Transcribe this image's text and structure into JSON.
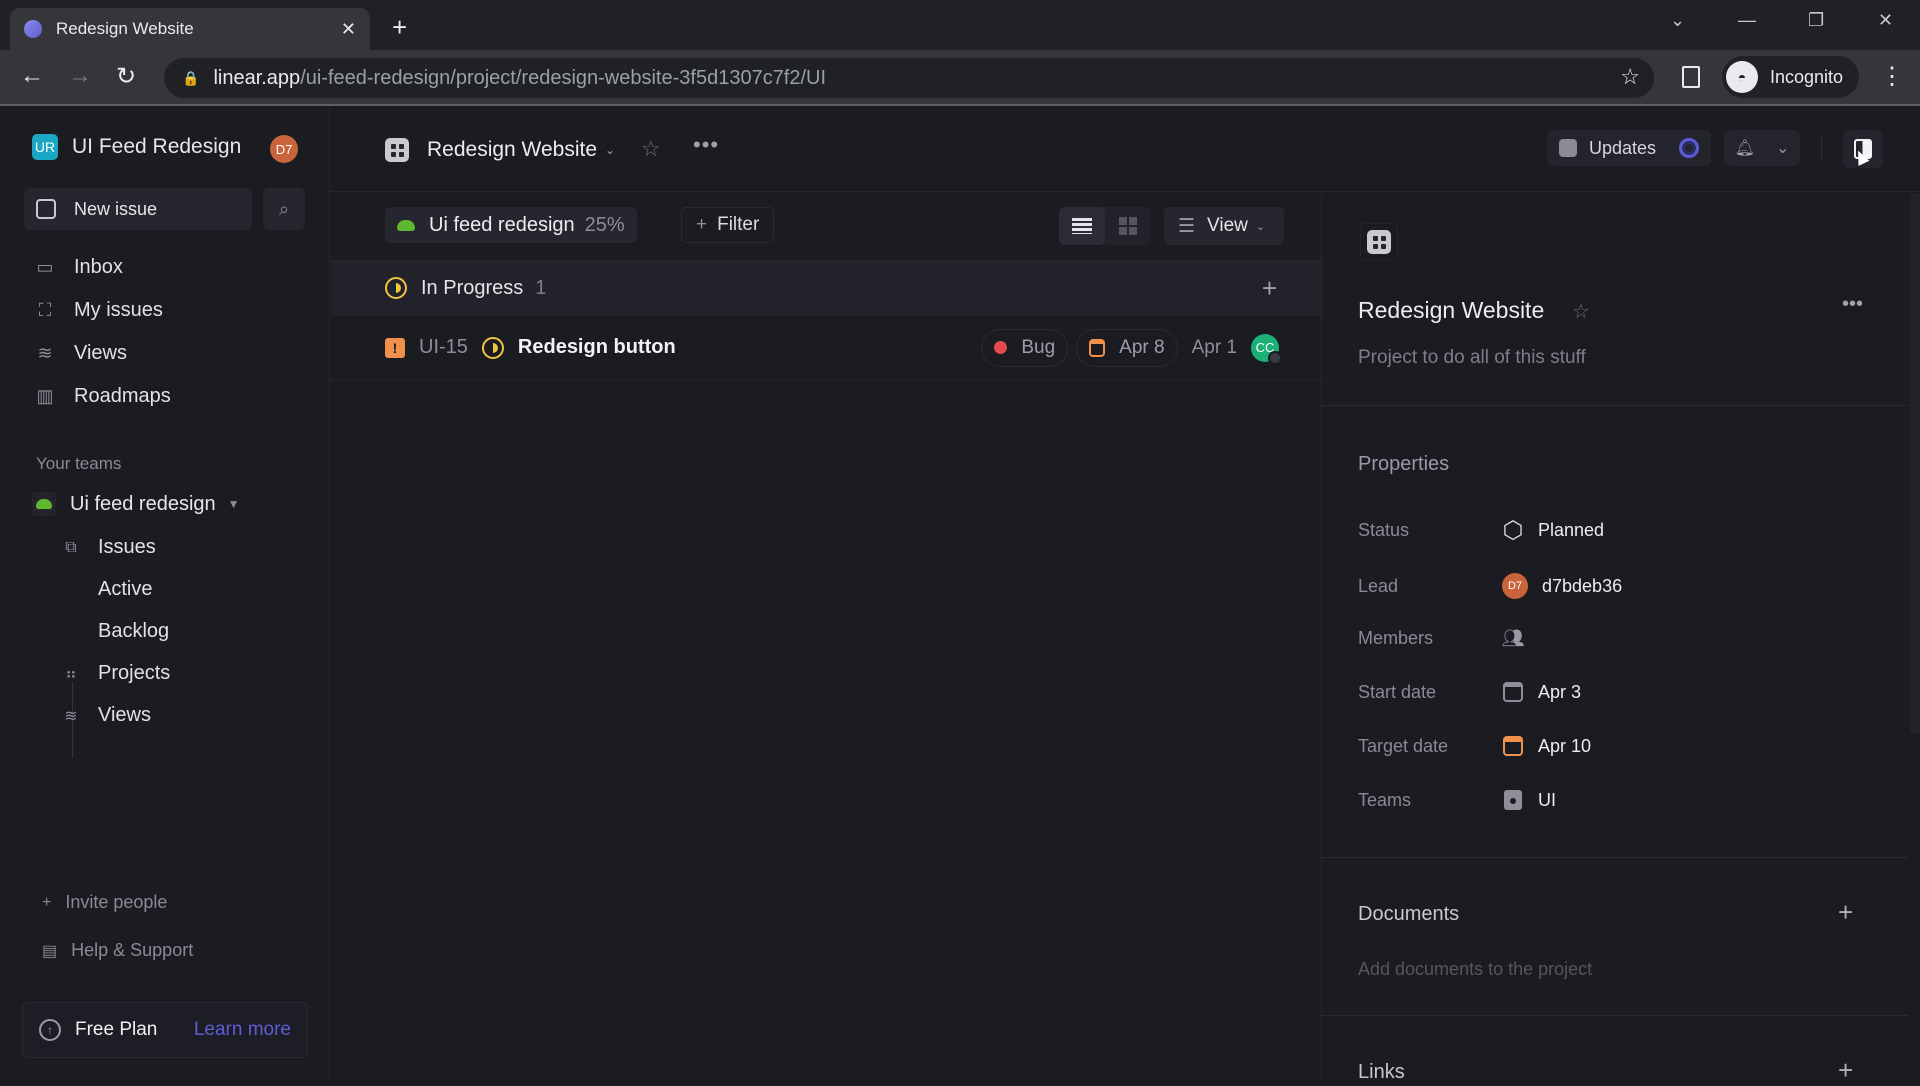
{
  "browser": {
    "tab_title": "Redesign Website",
    "url_host": "linear.app",
    "url_path": "/ui-feed-redesign/project/redesign-website-3f5d1307c7f2/UI",
    "profile_label": "Incognito"
  },
  "sidebar": {
    "workspace_logo": "UR",
    "workspace_name": "UI Feed Redesign",
    "user_avatar": "D7",
    "new_issue_label": "New issue",
    "nav": [
      {
        "label": "Inbox",
        "icon": "inbox-icon"
      },
      {
        "label": "My issues",
        "icon": "my-issues-icon"
      },
      {
        "label": "Views",
        "icon": "layers-icon"
      },
      {
        "label": "Roadmaps",
        "icon": "map-icon"
      }
    ],
    "teams_label": "Your teams",
    "team": {
      "name": "Ui feed redesign",
      "items": [
        {
          "label": "Issues"
        },
        {
          "label": "Active"
        },
        {
          "label": "Backlog"
        },
        {
          "label": "Projects"
        },
        {
          "label": "Views"
        }
      ]
    },
    "invite_label": "Invite people",
    "help_label": "Help & Support",
    "plan_label": "Free Plan",
    "learn_more_label": "Learn more"
  },
  "header": {
    "project_title": "Redesign Website",
    "updates_label": "Updates"
  },
  "list": {
    "team_chip_label": "Ui feed redesign",
    "team_chip_progress": "25%",
    "filter_label": "Filter",
    "view_label": "View",
    "group": {
      "status": "In Progress",
      "count": "1"
    },
    "issues": [
      {
        "id": "UI-15",
        "title": "Redesign button",
        "priority": "urgent",
        "label": "Bug",
        "due_date": "Apr 8",
        "created": "Apr 1",
        "assignee": "CC"
      }
    ]
  },
  "panel": {
    "title": "Redesign Website",
    "description": "Project to do all of this stuff",
    "properties_label": "Properties",
    "properties": {
      "status": {
        "label": "Status",
        "value": "Planned"
      },
      "lead": {
        "label": "Lead",
        "value": "d7bdeb36",
        "avatar": "D7"
      },
      "members": {
        "label": "Members"
      },
      "start_date": {
        "label": "Start date",
        "value": "Apr 3"
      },
      "target_date": {
        "label": "Target date",
        "value": "Apr 10"
      },
      "teams": {
        "label": "Teams",
        "value": "UI"
      }
    },
    "documents_label": "Documents",
    "documents_empty": "Add documents to the project",
    "links_label": "Links"
  },
  "colors": {
    "accent": "#5d5cd6",
    "in_progress": "#f0c43c",
    "bug": "#e5484d",
    "urgent": "#f0904a",
    "team_green": "#5fb830"
  }
}
